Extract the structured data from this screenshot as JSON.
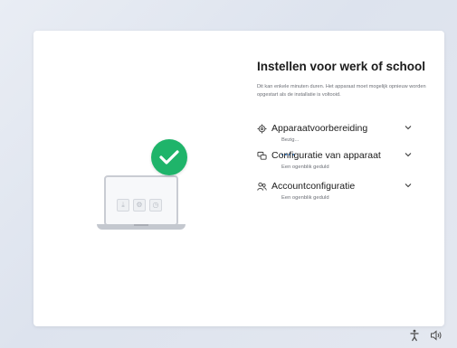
{
  "header": {
    "title": "Instellen voor werk of school",
    "description": "Dit kan enkele minuten duren. Het apparaat moet mogelijk opnieuw worden opgestart als de installatie is voltooid."
  },
  "steps": [
    {
      "label": "Apparaatvoorbereiding",
      "status": "Bezig...",
      "icon": "gear-icon"
    },
    {
      "label": "Configuratie van apparaat",
      "status": "Een ogenblik geduld",
      "icon": "device-config-icon"
    },
    {
      "label": "Accountconfiguratie",
      "status": "Een ogenblik geduld",
      "icon": "people-icon"
    }
  ],
  "colors": {
    "accent": "#2d7fd8",
    "success": "#1fb46a"
  }
}
